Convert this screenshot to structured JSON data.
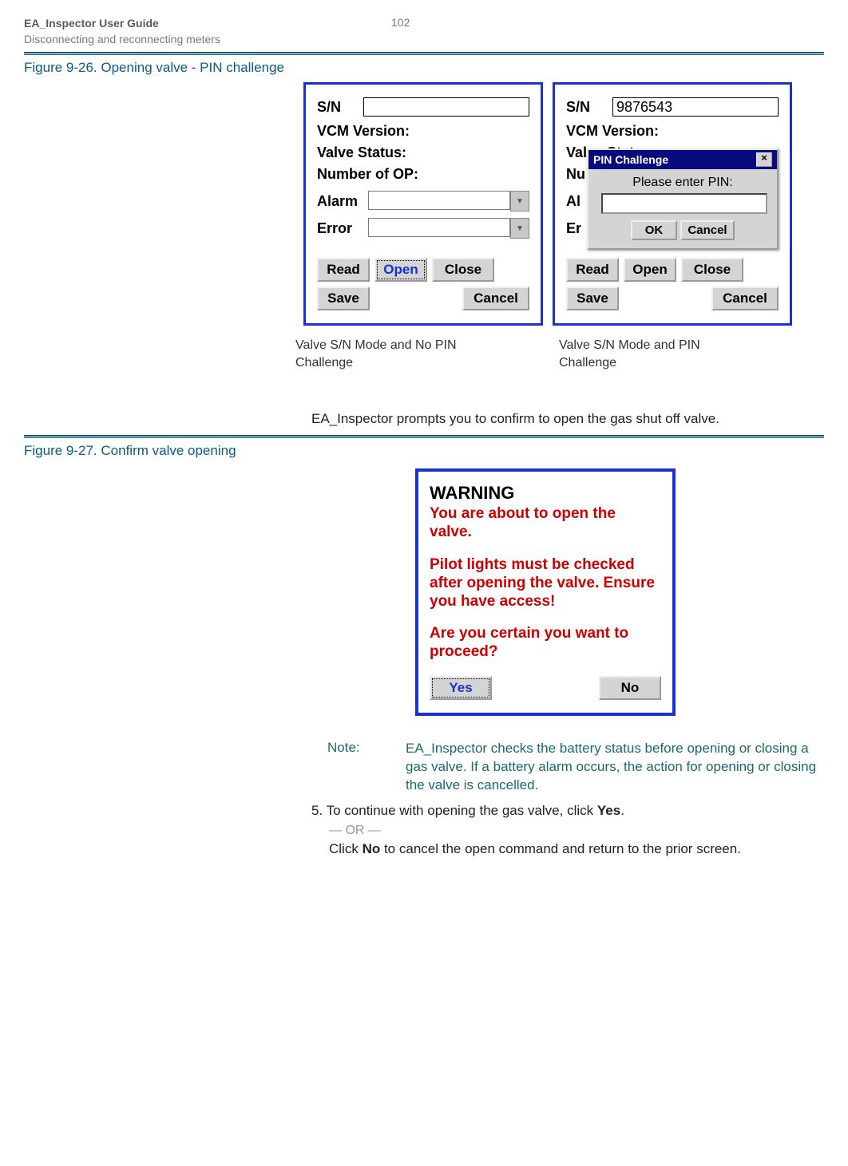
{
  "header": {
    "title": "EA_Inspector User Guide",
    "subtitle": "Disconnecting and reconnecting meters",
    "page": "102"
  },
  "fig1": {
    "caption": "Figure 9-26. Opening valve - PIN challenge",
    "panel_a": {
      "sn_label": "S/N",
      "sn_value": "",
      "vcm": "VCM Version:",
      "valve_status": "Valve Status:",
      "num_op": "Number of OP:",
      "alarm": "Alarm",
      "error": "Error",
      "read": "Read",
      "open": "Open",
      "close": "Close",
      "save": "Save",
      "cancel": "Cancel"
    },
    "panel_b": {
      "sn_label": "S/N",
      "sn_value": "9876543",
      "vcm": "VCM Version:",
      "valve_status": "Valve Status:",
      "num_op": "Nu",
      "alarm": "Al",
      "error": "Er",
      "read": "Read",
      "open": "Open",
      "close": "Close",
      "save": "Save",
      "cancel": "Cancel",
      "pin_title": "PIN Challenge",
      "pin_prompt": "Please enter PIN:",
      "pin_ok": "OK",
      "pin_cancel": "Cancel"
    },
    "cap_a": "Valve S/N Mode and No PIN Challenge",
    "cap_b": "Valve S/N Mode and PIN Challenge"
  },
  "body1": "EA_Inspector prompts you to confirm to open the gas shut off valve.",
  "fig2": {
    "caption": "Figure 9-27. Confirm valve opening",
    "title": "WARNING",
    "line1": "You are about to open the valve.",
    "line2": "Pilot lights must be checked after opening the valve. Ensure you have access!",
    "line3": "Are you certain you want to proceed?",
    "yes": "Yes",
    "no": "No"
  },
  "note": {
    "label": "Note:",
    "text": "EA_Inspector checks the battery status before opening or closing a gas valve. If a battery alarm occurs, the action for opening or closing the valve is cancelled."
  },
  "step5": {
    "num": "5.",
    "text_a": "To continue with opening the gas valve, click ",
    "yes": "Yes",
    "period": ".",
    "or": "— OR —",
    "text_b_pre": "Click ",
    "no": "No",
    "text_b_post": " to cancel the open command and return to the prior screen."
  }
}
